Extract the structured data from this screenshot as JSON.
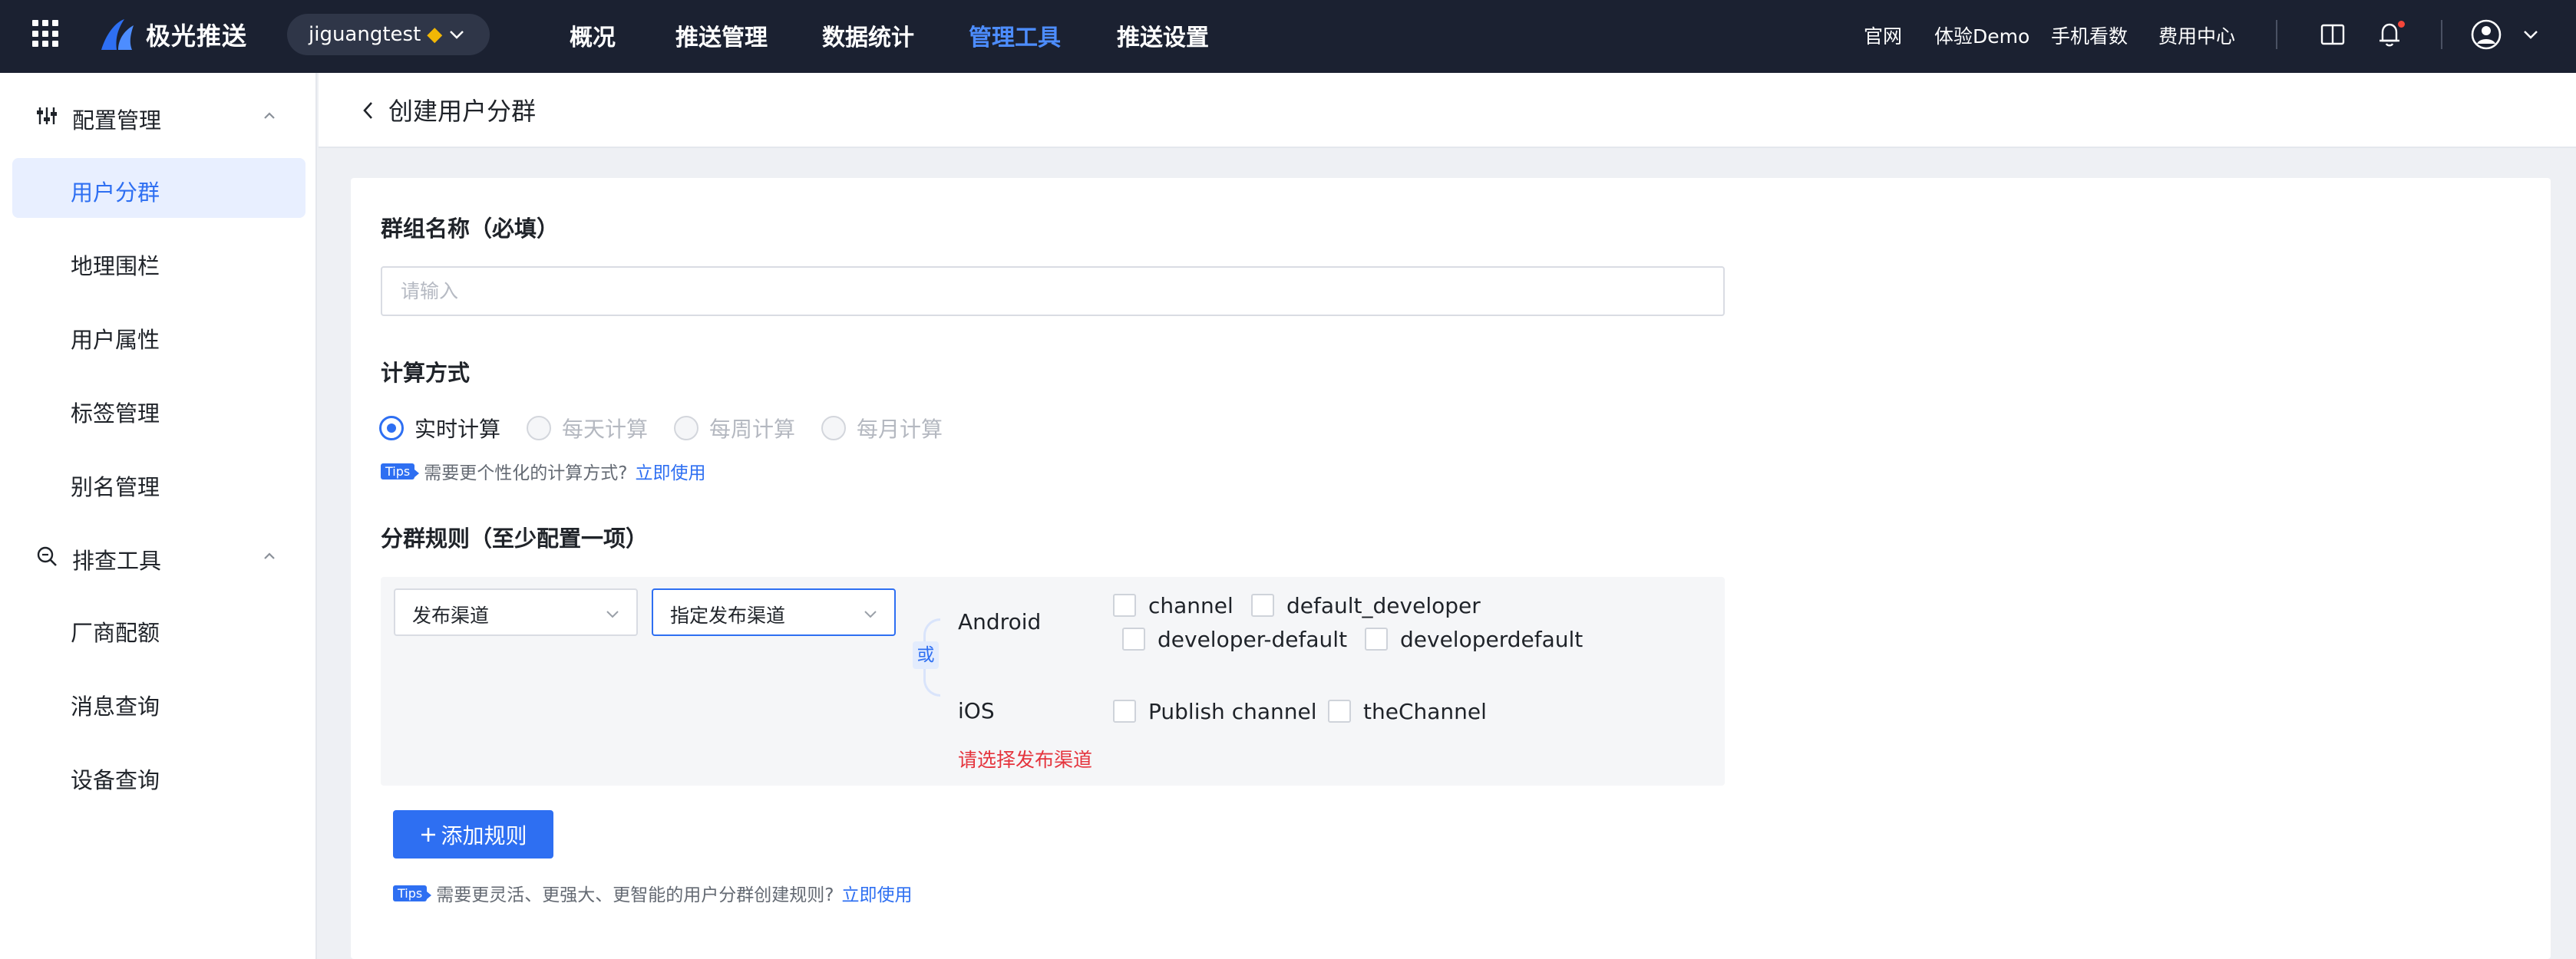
{
  "topbar": {
    "logo_text": "极光推送",
    "app_name": "jiguangtest",
    "app_badge_icon": "gem-icon",
    "nav": [
      {
        "label": "概况",
        "active": false
      },
      {
        "label": "推送管理",
        "active": false
      },
      {
        "label": "数据统计",
        "active": false
      },
      {
        "label": "管理工具",
        "active": true
      },
      {
        "label": "推送设置",
        "active": false
      }
    ],
    "links": [
      "官网",
      "体验Demo",
      "手机看数",
      "费用中心"
    ],
    "accent_color": "#4d8dff",
    "background_color": "#1b2131"
  },
  "sidebar": {
    "groups": [
      {
        "label": "配置管理",
        "icon": "sliders-icon",
        "expanded": true,
        "items": [
          {
            "label": "用户分群",
            "active": true
          },
          {
            "label": "地理围栏",
            "active": false
          },
          {
            "label": "用户属性",
            "active": false
          },
          {
            "label": "标签管理",
            "active": false
          },
          {
            "label": "别名管理",
            "active": false
          }
        ]
      },
      {
        "label": "排查工具",
        "icon": "search-debug-icon",
        "expanded": true,
        "items": [
          {
            "label": "厂商配额",
            "active": false
          },
          {
            "label": "消息查询",
            "active": false
          },
          {
            "label": "设备查询",
            "active": false
          }
        ]
      }
    ]
  },
  "page": {
    "title": "创建用户分群",
    "group_name": {
      "label": "群组名称（必填）",
      "value": "",
      "placeholder": "请输入"
    },
    "calc": {
      "label": "计算方式",
      "options": [
        {
          "label": "实时计算",
          "checked": true,
          "disabled": false
        },
        {
          "label": "每天计算",
          "checked": false,
          "disabled": true
        },
        {
          "label": "每周计算",
          "checked": false,
          "disabled": true
        },
        {
          "label": "每月计算",
          "checked": false,
          "disabled": true
        }
      ],
      "tips_badge": "Tips",
      "tips_text": "需要更个性化的计算方式?",
      "tips_link": "立即使用"
    },
    "rules": {
      "label": "分群规则（至少配置一项）",
      "select1": "发布渠道",
      "select2": "指定发布渠道",
      "or_label": "或",
      "platforms": [
        {
          "name": "Android",
          "channels": [
            "channel",
            "default_developer",
            "developer-default",
            "developerdefault"
          ]
        },
        {
          "name": "iOS",
          "channels": [
            "Publish channel",
            "theChannel"
          ]
        }
      ],
      "error": "请选择发布渠道",
      "error_color": "#e5343d"
    },
    "add_rule": {
      "icon": "plus-icon",
      "label": "添加规则"
    },
    "bottom_tips": {
      "badge": "Tips",
      "text": "需要更灵活、更强大、更智能的用户分群创建规则?",
      "link": "立即使用"
    },
    "primary_color": "#2e6ff2"
  }
}
